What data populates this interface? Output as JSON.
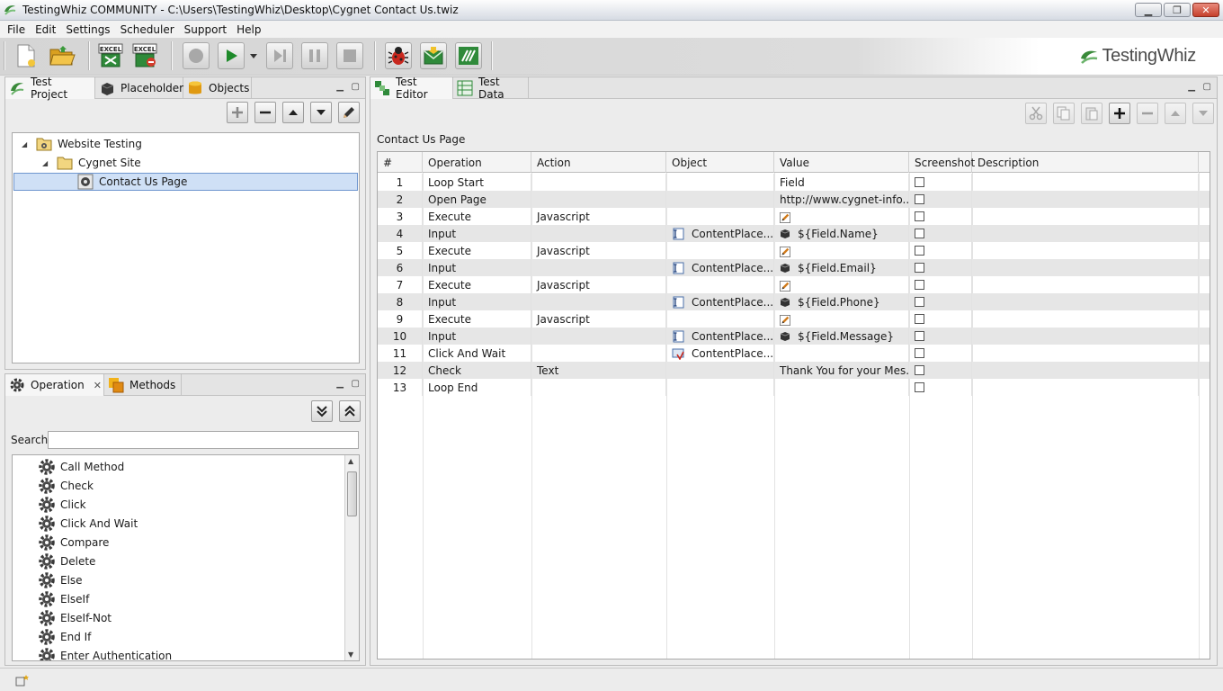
{
  "window": {
    "title": "TestingWhiz COMMUNITY - C:\\Users\\TestingWhiz\\Desktop\\Cygnet Contact Us.twiz",
    "controls": [
      "minimize",
      "restore",
      "close"
    ]
  },
  "menu": [
    "File",
    "Edit",
    "Settings",
    "Scheduler",
    "Support",
    "Help"
  ],
  "toolbar": {
    "excel_label": "EXCEL",
    "icons": [
      "new-file-icon",
      "open-folder-icon",
      "excel-import-icon",
      "excel-export-icon",
      "record-icon",
      "play-icon",
      "step-icon",
      "pause-icon",
      "stop-icon",
      "debug-bug-icon",
      "email-icon",
      "fx-icon"
    ]
  },
  "brand": {
    "name": "TestingWhiz",
    "color": "#4a4a4a",
    "accent": "#3a8a3a"
  },
  "left_top": {
    "tabs": [
      "Test Project",
      "Placeholder",
      "Objects"
    ],
    "tree": [
      {
        "label": "Website Testing",
        "level": 0
      },
      {
        "label": "Cygnet Site",
        "level": 1
      },
      {
        "label": "Contact Us Page",
        "level": 2,
        "selected": true
      }
    ]
  },
  "left_bottom": {
    "tabs": [
      "Operation",
      "Methods"
    ],
    "search_label": "Search",
    "search_value": "",
    "operations": [
      "Call Method",
      "Check",
      "Click",
      "Click And Wait",
      "Compare",
      "Delete",
      "Else",
      "ElseIf",
      "ElseIf-Not",
      "End If",
      "Enter Authentication"
    ]
  },
  "editor": {
    "tabs": [
      "Test Editor",
      "Test Data"
    ],
    "page_label": "Contact Us Page",
    "columns": [
      "#",
      "Operation",
      "Action",
      "Object",
      "Value",
      "Screenshot",
      "Description"
    ],
    "rows": [
      {
        "n": "1",
        "op": "Loop Start",
        "action": "",
        "obj": "",
        "obj_icon": "",
        "val": "Field",
        "val_icon": ""
      },
      {
        "n": "2",
        "op": "Open Page",
        "action": "",
        "obj": "",
        "obj_icon": "",
        "val": "http://www.cygnet-info...",
        "val_icon": ""
      },
      {
        "n": "3",
        "op": "Execute",
        "action": "Javascript",
        "obj": "",
        "obj_icon": "",
        "val": "",
        "val_icon": "pencil"
      },
      {
        "n": "4",
        "op": "Input",
        "action": "",
        "obj": "ContentPlace...",
        "obj_icon": "textfield",
        "val": "${Field.Name}",
        "val_icon": "block"
      },
      {
        "n": "5",
        "op": "Execute",
        "action": "Javascript",
        "obj": "",
        "obj_icon": "",
        "val": "",
        "val_icon": "pencil"
      },
      {
        "n": "6",
        "op": "Input",
        "action": "",
        "obj": "ContentPlace...",
        "obj_icon": "textfield",
        "val": "${Field.Email}",
        "val_icon": "block"
      },
      {
        "n": "7",
        "op": "Execute",
        "action": "Javascript",
        "obj": "",
        "obj_icon": "",
        "val": "",
        "val_icon": "pencil"
      },
      {
        "n": "8",
        "op": "Input",
        "action": "",
        "obj": "ContentPlace...",
        "obj_icon": "textfield",
        "val": "${Field.Phone}",
        "val_icon": "block"
      },
      {
        "n": "9",
        "op": "Execute",
        "action": "Javascript",
        "obj": "",
        "obj_icon": "",
        "val": "",
        "val_icon": "pencil"
      },
      {
        "n": "10",
        "op": "Input",
        "action": "",
        "obj": "ContentPlace...",
        "obj_icon": "textfield",
        "val": "${Field.Message}",
        "val_icon": "block"
      },
      {
        "n": "11",
        "op": "Click And Wait",
        "action": "",
        "obj": "ContentPlace...",
        "obj_icon": "button",
        "val": "",
        "val_icon": ""
      },
      {
        "n": "12",
        "op": "Check",
        "action": "Text",
        "obj": "",
        "obj_icon": "",
        "val": "Thank You for your Mes...",
        "val_icon": ""
      },
      {
        "n": "13",
        "op": "Loop End",
        "action": "",
        "obj": "",
        "obj_icon": "",
        "val": "",
        "val_icon": ""
      }
    ]
  }
}
